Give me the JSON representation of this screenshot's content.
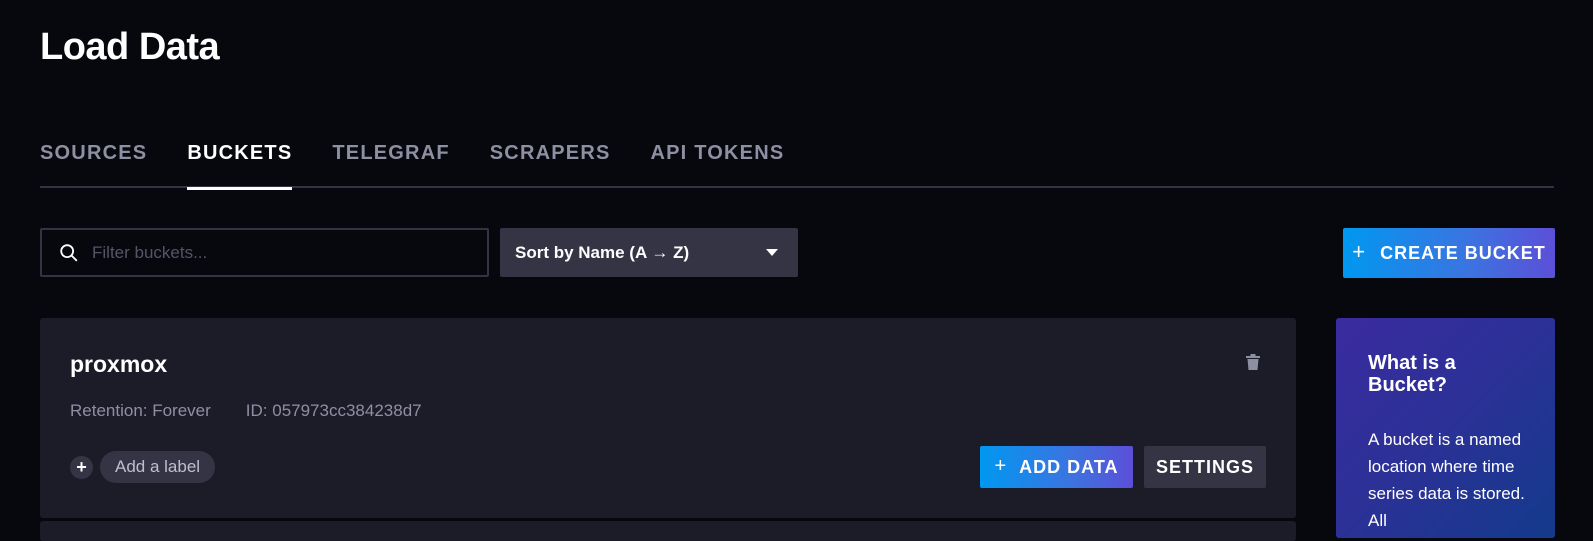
{
  "page": {
    "title": "Load Data"
  },
  "tabs": [
    {
      "label": "SOURCES",
      "active": false
    },
    {
      "label": "BUCKETS",
      "active": true
    },
    {
      "label": "TELEGRAF",
      "active": false
    },
    {
      "label": "SCRAPERS",
      "active": false
    },
    {
      "label": "API TOKENS",
      "active": false
    }
  ],
  "toolbar": {
    "search_placeholder": "Filter buckets...",
    "search_value": "",
    "sort_label": "Sort by Name (A → Z)",
    "create_label": "CREATE BUCKET"
  },
  "bucket": {
    "name": "proxmox",
    "retention": "Retention: Forever",
    "id": "ID: 057973cc384238d7",
    "label_plus": "+",
    "add_label": "Add a label",
    "add_data_label": "ADD DATA",
    "settings_label": "SETTINGS"
  },
  "info": {
    "title": "What is a Bucket?",
    "text": "A bucket is a named location where time series data is stored. All"
  },
  "colors": {
    "background": "#07080e",
    "card": "#1c1c29",
    "accent_start": "#0098f0",
    "accent_end": "#5c4fd8",
    "muted_text": "#8f8fa3"
  }
}
